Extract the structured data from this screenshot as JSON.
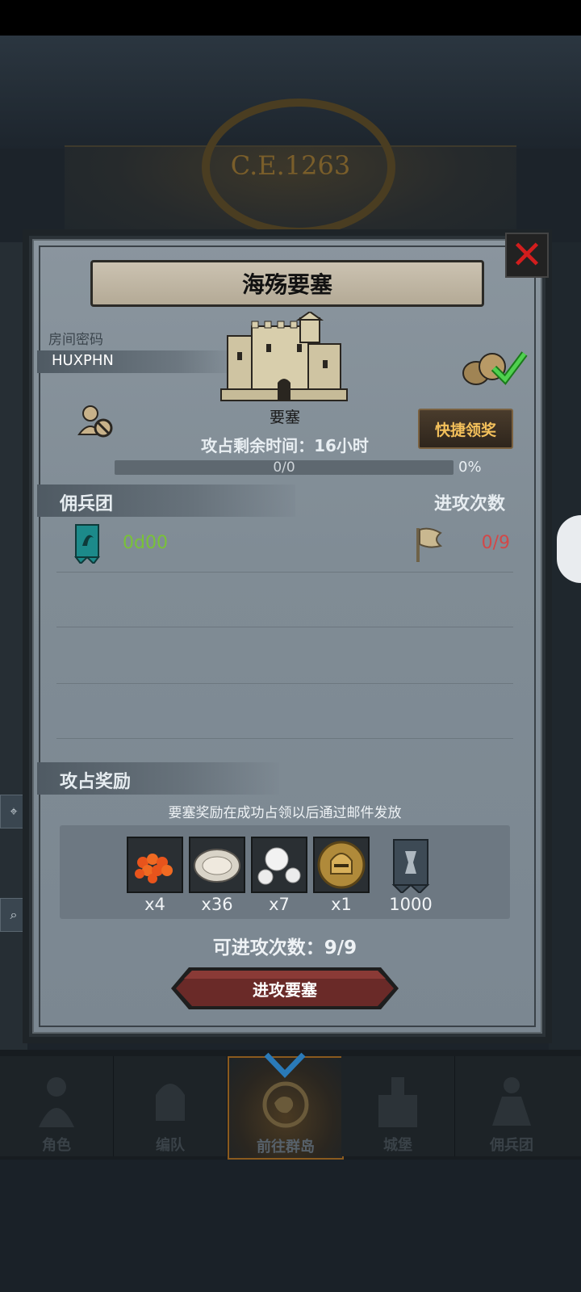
{
  "era": "C.E.1263",
  "dialog": {
    "title": "海殇要塞",
    "room": {
      "label": "房间密码",
      "code": "HUXPHN"
    },
    "fortress_name": "要塞",
    "quick_claim_label": "快捷领奖",
    "time_remaining": "攻占剩余时间：16小时",
    "progress": {
      "text": "0/0",
      "percent_label": "0%",
      "fraction": 0
    },
    "mercenary_header": "佣兵团",
    "attack_times_header": "进攻次数",
    "mercenary_row": {
      "id": "0d00",
      "count": "0/9"
    },
    "rewards_header": "攻占奖励",
    "rewards_note": "要塞奖励在成功占领以后通过邮件发放",
    "rewards": [
      {
        "icon": "fish-roe-icon",
        "qty": "x4"
      },
      {
        "icon": "oyster-icon",
        "qty": "x36"
      },
      {
        "icon": "pearls-icon",
        "qty": "x7"
      },
      {
        "icon": "knight-helmet-coin-icon",
        "qty": "x1"
      },
      {
        "icon": "guild-banner-icon",
        "qty": "1000"
      }
    ],
    "attack_count": "可进攻次数：9/9",
    "attack_button": "进攻要塞"
  },
  "nav": [
    {
      "label": "角色",
      "icon": "character-icon"
    },
    {
      "label": "编队",
      "icon": "formation-icon"
    },
    {
      "label": "前往群岛",
      "icon": "islands-icon",
      "active": true
    },
    {
      "label": "城堡",
      "icon": "castle-icon"
    },
    {
      "label": "佣兵团",
      "icon": "mercenary-icon"
    }
  ],
  "colors": {
    "panel": "#808c95",
    "accent_gold": "#f3c05b",
    "count_red": "#d24848",
    "id_green": "#79c238",
    "attack_button": "#6a2a28"
  }
}
